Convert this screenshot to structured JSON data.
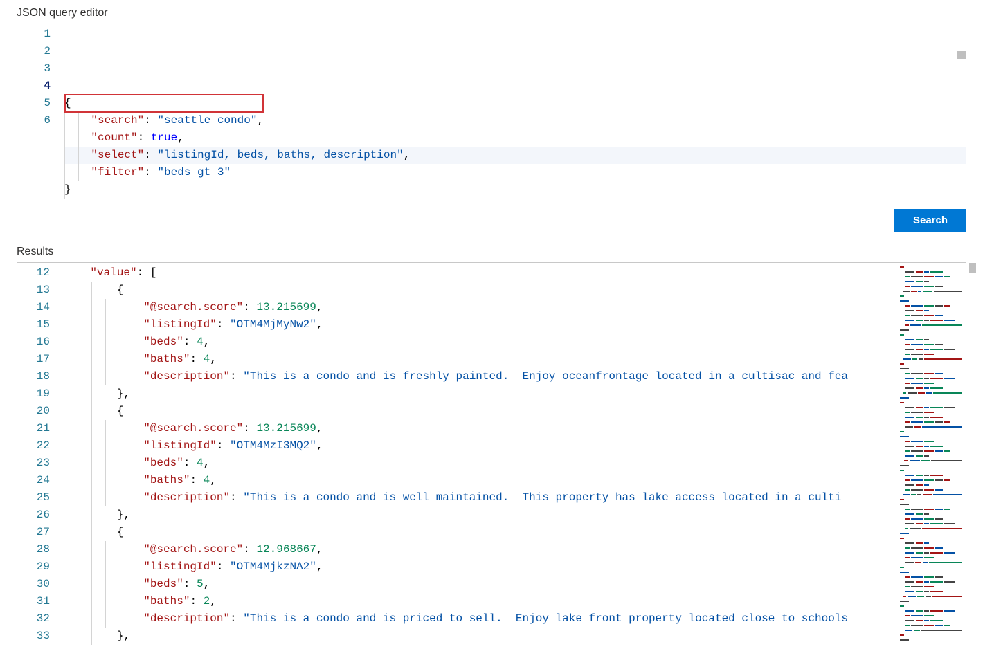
{
  "labels": {
    "editor_title": "JSON query editor",
    "results_title": "Results",
    "search_button": "Search"
  },
  "query": {
    "open_brace": "{",
    "search_key": "\"search\"",
    "search_val": "\"seattle condo\"",
    "count_key": "\"count\"",
    "count_val": "true",
    "select_key": "\"select\"",
    "select_val": "\"listingId, beds, baths, description\"",
    "filter_key": "\"filter\"",
    "filter_val": "\"beds gt 3\"",
    "close_brace": "}"
  },
  "query_line_numbers": [
    "1",
    "2",
    "3",
    "4",
    "5",
    "6"
  ],
  "query_active_line_index": 3,
  "results_start_line": 12,
  "results": {
    "value_key": "\"value\"",
    "open_bracket": "[",
    "obj_open": "{",
    "obj_close_comma": "},",
    "score_key": "\"@search.score\"",
    "listing_key": "\"listingId\"",
    "beds_key": "\"beds\"",
    "baths_key": "\"baths\"",
    "desc_key": "\"description\"",
    "items": [
      {
        "score": "13.215699",
        "listingId": "\"OTM4MjMyNw2\"",
        "beds": "4",
        "baths": "4",
        "description": "\"This is a condo and is freshly painted.  Enjoy oceanfrontage located in a cultisac and fea"
      },
      {
        "score": "13.215699",
        "listingId": "\"OTM4MzI3MQ2\"",
        "beds": "4",
        "baths": "4",
        "description": "\"This is a condo and is well maintained.  This property has lake access located in a culti"
      },
      {
        "score": "12.968667",
        "listingId": "\"OTM4MjkzNA2\"",
        "beds": "5",
        "baths": "2",
        "description": "\"This is a condo and is priced to sell.  Enjoy lake front property located close to schools"
      }
    ]
  }
}
